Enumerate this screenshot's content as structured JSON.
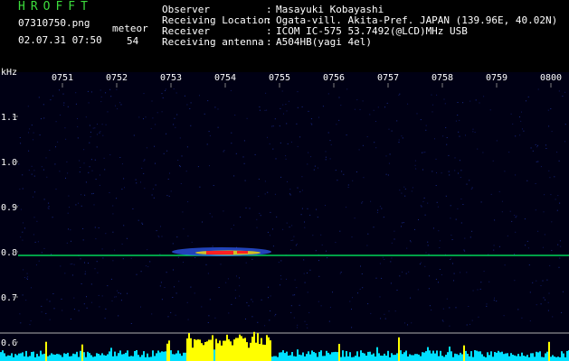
{
  "header": {
    "app_title": "HROFFT",
    "filename": "07310750.png",
    "datetime": "02.07.31 07:50",
    "meteor_label": "meteor",
    "meteor_count": "54"
  },
  "info": [
    {
      "label": "Observer",
      "value": "Masayuki Kobayashi"
    },
    {
      "label": "Receiving Location",
      "value": "Ogata-vill. Akita-Pref. JAPAN (139.96E, 40.02N)"
    },
    {
      "label": "Receiver",
      "value": "ICOM IC-575 53.7492(@LCD)MHz USB"
    },
    {
      "label": "Receiving antenna",
      "value": "A504HB(yagi 4el)"
    }
  ],
  "spectrogram": {
    "unit_label": "kHz",
    "time_ticks": [
      "0751",
      "0752",
      "0753",
      "0754",
      "0755",
      "0756",
      "0757",
      "0758",
      "0759",
      "0800"
    ],
    "freq_ticks": [
      "1.1",
      "1.0",
      "0.9",
      "0.8",
      "0.7",
      "0.6"
    ],
    "colors": {
      "background": "#000014",
      "signal_line": "#00ff66",
      "baseline": "#b0b0b0",
      "noise_bar": "#00e0ff",
      "meteor_peak": "#ffff00",
      "echo_hot": "#ff2020",
      "echo_warm": "#ffe000",
      "echo_cool": "#3060ff"
    }
  }
}
